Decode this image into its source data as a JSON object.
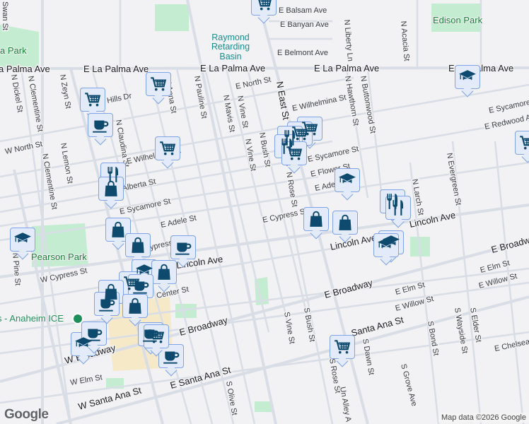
{
  "map": {
    "streets": {
      "swan": "Swan St",
      "la_palma_w": "a Palma Ave",
      "la_palma_1": "E La Palma Ave",
      "la_palma_2": "E La Palma Ave",
      "la_palma_3": "E La Palma Ave",
      "la_palma_4": "E La Palma Ave",
      "dickel": "N Dickel St",
      "clementine1": "N Clementine St",
      "clementine2": "N Clementine St",
      "zeyn": "N Zeyn St",
      "lemon": "N Lemon St",
      "hills": "Hills Dr",
      "w_north": "W North St",
      "claudina": "N Claudina St",
      "anaheim": "N Anna St",
      "pauline": "N Pauline St",
      "mavis": "N Mavis St",
      "vine1": "N Vine St",
      "vine2": "N Vine St",
      "bush": "N Bush St",
      "e_north": "E North St",
      "wilhelmina_w": "E Wilhelmina St",
      "wilhelmina_e": "E Wilhelmina St",
      "alberta": "E Alberta St",
      "sycamore_w": "E Sycamore St",
      "sycamore_m": "E Sycamore St",
      "sycamore_e": "E Sycamore",
      "adele": "E Adele St",
      "adele_e": "E Adele St",
      "flower": "E Flower St",
      "cypress_e": "E Cypress St",
      "cypress_w": "W Cypress St",
      "cypress_m": "Cypress St",
      "balsam": "E Balsam Ave",
      "banyan": "E Banyan Ave",
      "belmont": "E Belmont Ave",
      "liberty": "N Liberty Ln",
      "hawthorn": "N Hawthorn St",
      "buttonwood": "N Buttonwood St",
      "acacia": "N Acacia St",
      "redwood": "E Redwood Ave",
      "evergreen": "N Evergreen St",
      "larch": "N Larch St",
      "east": "N East St",
      "rose": "N Rose St",
      "lincoln1": "Lincoln Ave",
      "lincoln2": "Lincoln Ave",
      "lincoln3": "Lincoln Ave",
      "broadway_e1": "E Broadway",
      "broadway_e2": "E Broadway",
      "broadway_e3": "E Broadway",
      "broadway_w": "W Broadway",
      "elm_e1": "E Elm St",
      "elm_e2": "E Elm St",
      "elm_w": "W Elm St",
      "willow1": "E Willow St",
      "willow2": "E Willow St",
      "center": "Center St",
      "santa_ana_e": "E Santa Ana St",
      "santa_ana_w": "W Santa Ana St",
      "santa_ana_m": "Santa Ana St",
      "s_vine": "S Vine St",
      "s_bush": "S Bush St",
      "s_rose": "S Rose St",
      "un_alley": "Un Alley A",
      "s_dawn": "S Dawn St",
      "s_grove": "S Grove Ave",
      "s_bond": "S Bond St",
      "s_wayside": "S Wayside St",
      "s_elder": "S Elder St",
      "chelsea": "E Chelsea",
      "s_olive": "S Olive St",
      "pine": "N Pine St"
    },
    "places": {
      "basin": [
        "Raymond",
        "Retarding",
        "Basin"
      ],
      "edison_park": "Edison Park",
      "la_palma_park": "a Park",
      "pearson_park": "Pearson Park",
      "anaheim_ice": "s - Anaheim ICE"
    },
    "markers": [
      "cart",
      "cart",
      "coffee",
      "cart",
      "restaurant",
      "bag",
      "cart",
      "graduation",
      "cart",
      "cart",
      "restaurant",
      "restaurant",
      "cart",
      "graduation",
      "restaurant",
      "restaurant",
      "bag",
      "bag",
      "graduation",
      "graduation",
      "graduation",
      "bag",
      "bag",
      "coffee",
      "graduation",
      "bag",
      "cart",
      "coffee",
      "bag",
      "coffee",
      "bag",
      "coffee",
      "graduation",
      "cart",
      "coffee",
      "coffee",
      "cart",
      "cart"
    ],
    "logo": "Google",
    "attribution": "Map data ©2026 Google"
  },
  "colors": {
    "marker_icon": "#0d4a6e",
    "marker_bg": "#e3ebfb",
    "park": "#c3ecd1"
  }
}
